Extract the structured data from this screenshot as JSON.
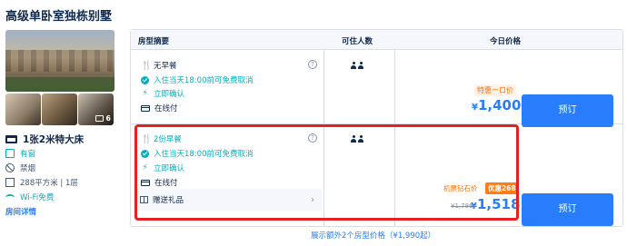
{
  "room": {
    "title": "高级单卧室独栋别墅",
    "photo_count": "6",
    "bed": "1张2米特大床",
    "features": [
      "有窗",
      "禁烟",
      "288平方米 | 1层",
      "Wi-Fi免费"
    ],
    "detail_link": "房间详情"
  },
  "table": {
    "headers": {
      "summary": "房型摘要",
      "guests": "可住人数",
      "price": "今日价格"
    }
  },
  "offers": [
    {
      "meal": "无早餐",
      "cancel": "入住当天18:00前可免费取消",
      "confirm": "立即确认",
      "payment": "在线付",
      "deal_tag": "特惠一口价",
      "currency": "¥",
      "price": "1,400",
      "book_label": "预订",
      "guests": 2
    },
    {
      "meal": "2份早餐",
      "cancel": "入住当天18:00前可免费取消",
      "confirm": "立即确认",
      "payment": "在线付",
      "gift": "赠送礼品",
      "promo": "机票钻石价",
      "promo_badge": "优惠268",
      "old_price": "¥1,786",
      "currency": "¥",
      "price": "1,518",
      "book_label": "预订",
      "guests": 2
    }
  ],
  "more_link": "展示额外2个房型价格（¥1,990起）",
  "colors": {
    "accent": "#287dfa",
    "teal": "#06aebd",
    "orange": "#ff6f00",
    "highlight": "#e52020"
  }
}
